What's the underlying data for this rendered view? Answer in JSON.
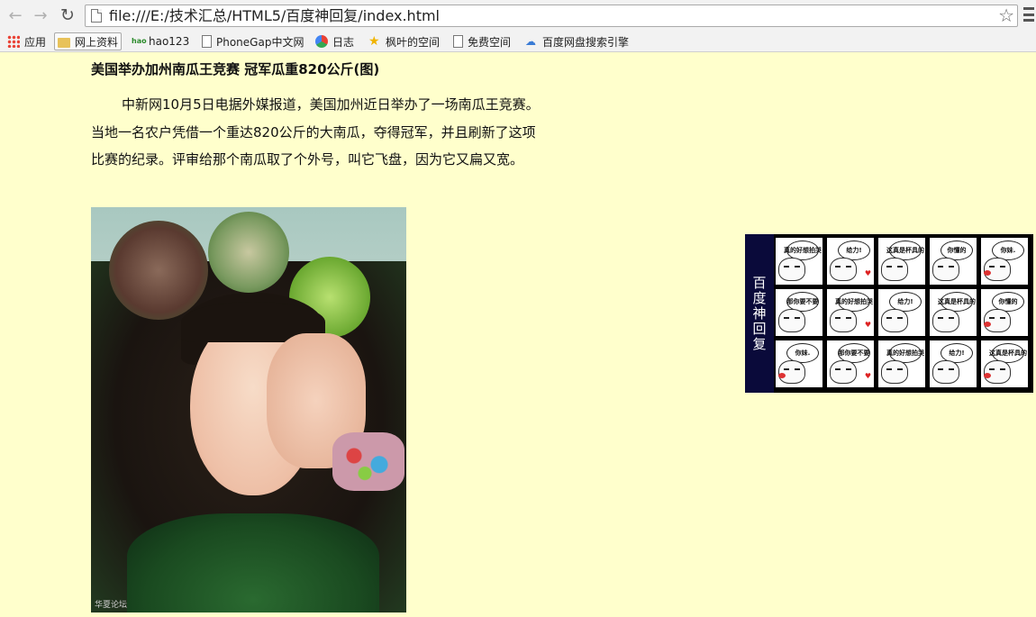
{
  "browser": {
    "url": "file:///E:/技术汇总/HTML5/百度神回复/index.html",
    "bookmarks": [
      {
        "label": "应用",
        "icon": "apps-grid-icon"
      },
      {
        "label": "网上资料",
        "icon": "folder-icon"
      },
      {
        "label": "hao123",
        "icon": "hao123-icon"
      },
      {
        "label": "PhoneGap中文网",
        "icon": "page-icon"
      },
      {
        "label": "日志",
        "icon": "color-ball-icon"
      },
      {
        "label": "枫叶的空间",
        "icon": "star-icon"
      },
      {
        "label": "免费空间",
        "icon": "page-icon"
      },
      {
        "label": "百度网盘搜索引擎",
        "icon": "cloud-icon"
      }
    ]
  },
  "article": {
    "title": "美国举办加州南瓜王竞赛 冠军瓜重820公斤(图)",
    "body": "中新网10月5日电据外媒报道，美国加州近日举办了一场南瓜王竞赛。当地一名农户凭借一个重达820公斤的大南瓜，夺得冠军，并且刷新了这项比赛的纪录。评审给那个南瓜取了个外号，叫它飞盘，因为它又扁又宽。",
    "photo_watermark": "华夏论坛"
  },
  "panel": {
    "tab_label": "百度神回复",
    "stickers": [
      "真的好想拍哭",
      "给力!",
      "这真是杯具的",
      "你懂的",
      "你妹.",
      "那你要不要",
      "真的好想拍哭",
      "给力!",
      "这真是杯具的",
      "你懂的",
      "你妹.",
      "那你要不要",
      "真的好想拍哭",
      "给力!",
      "这真是杯具的"
    ]
  }
}
